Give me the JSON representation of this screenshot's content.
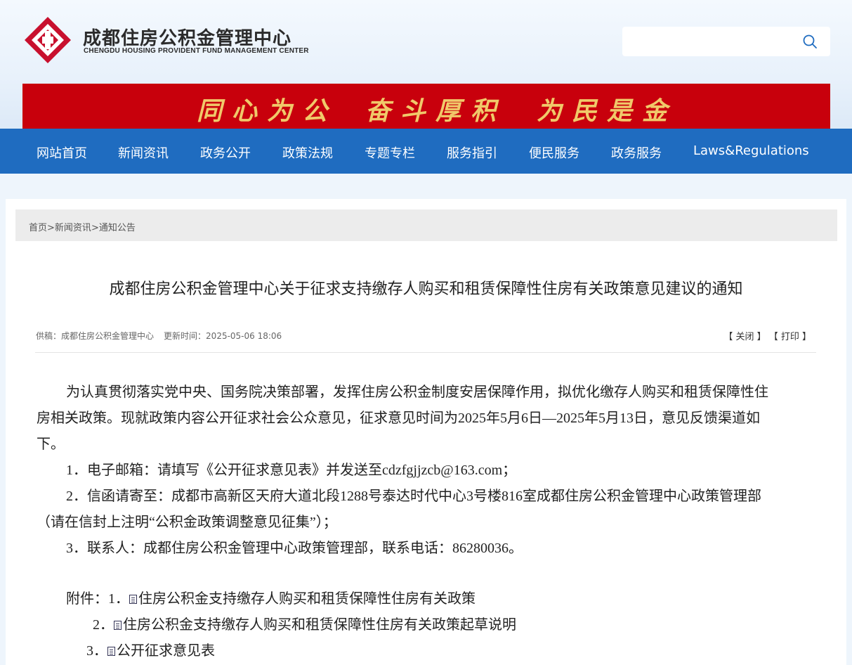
{
  "header": {
    "title": "成都住房公积金管理中心",
    "subtitle": "CHENGDU HOUSING PROVIDENT FUND MANAGEMENT CENTER",
    "logo_icon": "chengdu-hpf-logo",
    "search": {
      "placeholder": "",
      "icon": "search-icon"
    }
  },
  "banner": {
    "slogans": [
      "同心为公",
      "奋斗厚积",
      "为民是金"
    ],
    "background": "#c8000c",
    "text_color": "#f0c96a"
  },
  "nav": {
    "background": "#1f6cc0",
    "items": [
      "网站首页",
      "新闻资讯",
      "政务公开",
      "政策法规",
      "专题专栏",
      "服务指引",
      "便民服务",
      "政务服务",
      "Laws&Regulations"
    ]
  },
  "breadcrumb": {
    "items": [
      "首页",
      "新闻资讯",
      "通知公告"
    ],
    "separator": ">"
  },
  "article": {
    "title": "成都住房公积金管理中心关于征求支持缴存人购买和租赁保障性住房有关政策意见建议的通知",
    "source_label": "供稿：",
    "source": "成都住房公积金管理中心",
    "updated_label": "更新时间：",
    "updated": "2025-05-06 18:06",
    "close_label": "【 关闭 】",
    "print_label": "【 打印 】",
    "body": {
      "p1_line1": "为认真贯彻落实党中央、国务院决策部署，发挥住房公积金制度安居保障作用，拟优化缴存人购买和租赁保障性住",
      "p1_line2": "房相关政策。现就政策内容公开征求社会公众意见，征求意见时间为2025年5月6日—2025年5月13日，意见反馈渠道如",
      "p1_line3": "下。",
      "item1": "1．电子邮箱：请填写《公开征求意见表》并发送至cdzfgjjzcb@163.com；",
      "item2_line1": "2．信函请寄至：成都市高新区天府大道北段1288号泰达时代中心3号楼816室成都住房公积金管理中心政策管理部",
      "item2_line2": "（请在信封上注明“公积金政策调整意见征集”）；",
      "item3": "3．联系人：成都住房公积金管理中心政策管理部，联系电话：86280036。"
    },
    "attachments": {
      "label": "附件：",
      "items": [
        {
          "num": "1．",
          "name": "住房公积金支持缴存人购买和租赁保障性住房有关政策"
        },
        {
          "num": "2．",
          "name": "住房公积金支持缴存人购买和租赁保障性住房有关政策起草说明"
        },
        {
          "num": "3．",
          "name": "公开征求意见表"
        }
      ]
    }
  }
}
